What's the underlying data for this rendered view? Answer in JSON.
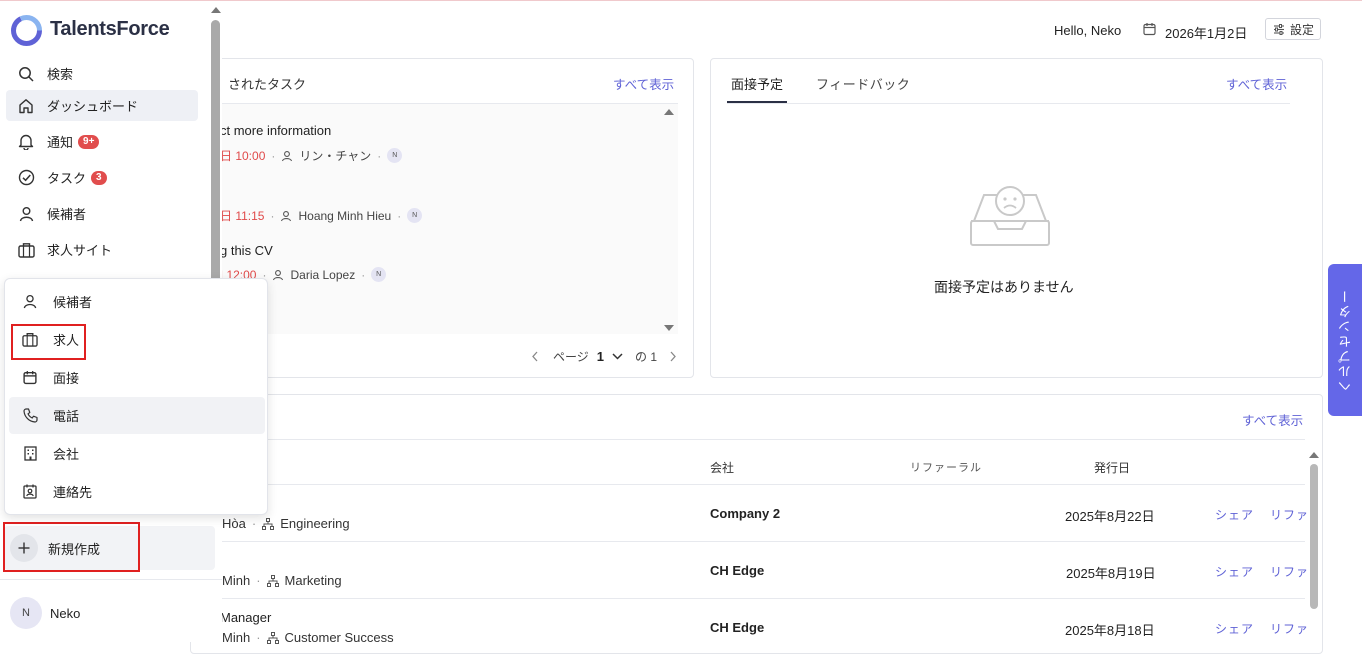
{
  "header": {
    "greeting": "Hello, Neko",
    "date": "2026年1月2日",
    "settings_label": "設定"
  },
  "tasks_card": {
    "title": "されたタスク",
    "view_all": "すべて表示",
    "items": [
      {
        "title": "ct more information",
        "time": "日 10:00",
        "assignee": "リン・チャン",
        "avatar": "N"
      },
      {
        "title": "",
        "time": "日 11:15",
        "assignee": "Hoang Minh Hieu",
        "avatar": "N"
      },
      {
        "title": "g this CV",
        "time": "| 12:00",
        "assignee": "Daria Lopez",
        "avatar": "N"
      }
    ],
    "pager": {
      "page_label": "ページ",
      "page": "1",
      "of_label": "の 1"
    }
  },
  "interviews_card": {
    "tabs": [
      {
        "label": "面接予定"
      },
      {
        "label": "フィードバック"
      }
    ],
    "view_all": "すべて表示",
    "empty_text": "面接予定はありません"
  },
  "jobs_card": {
    "view_all": "すべて表示",
    "columns": {
      "company": "会社",
      "referral": "リファーラル",
      "published": "発行日"
    },
    "rows": [
      {
        "title": "",
        "sub_left": "Hòa",
        "department": "Engineering",
        "company": "Company 2",
        "date": "2025年8月22日",
        "share": "シェア",
        "refer": "リファ"
      },
      {
        "title": "",
        "sub_left": "Minh",
        "department": "Marketing",
        "company": "CH Edge",
        "date": "2025年8月19日",
        "share": "シェア",
        "refer": "リファ"
      },
      {
        "title": "Manager",
        "sub_left": "Minh",
        "department": "Customer Success",
        "company": "CH Edge",
        "date": "2025年8月18日",
        "share": "シェア",
        "refer": "リファ"
      }
    ]
  },
  "help_center": {
    "label": "ヘルプセンター"
  },
  "sidebar": {
    "logo": "TalentsForce",
    "items": [
      {
        "label": "検索",
        "icon": "search-icon"
      },
      {
        "label": "ダッシュボード",
        "icon": "home-icon"
      },
      {
        "label": "通知",
        "icon": "bell-icon",
        "badge": "9+"
      },
      {
        "label": "タスク",
        "icon": "check-circle-icon",
        "badge": "3"
      },
      {
        "label": "候補者",
        "icon": "user-icon"
      },
      {
        "label": "求人サイト",
        "icon": "briefcase-icon"
      }
    ],
    "new_button": "新規作成",
    "user": {
      "initial": "N",
      "name": "Neko"
    }
  },
  "create_menu": {
    "items": [
      {
        "label": "候補者",
        "icon": "user-icon"
      },
      {
        "label": "求人",
        "icon": "briefcase-icon"
      },
      {
        "label": "面接",
        "icon": "calendar-icon"
      },
      {
        "label": "電話",
        "icon": "phone-icon"
      },
      {
        "label": "会社",
        "icon": "building-icon"
      },
      {
        "label": "連絡先",
        "icon": "contact-icon"
      }
    ]
  },
  "colors": {
    "accent": "#5f62d6",
    "help_tab": "#6467e8",
    "badge": "#e14d4d",
    "highlight": "#e02020"
  }
}
